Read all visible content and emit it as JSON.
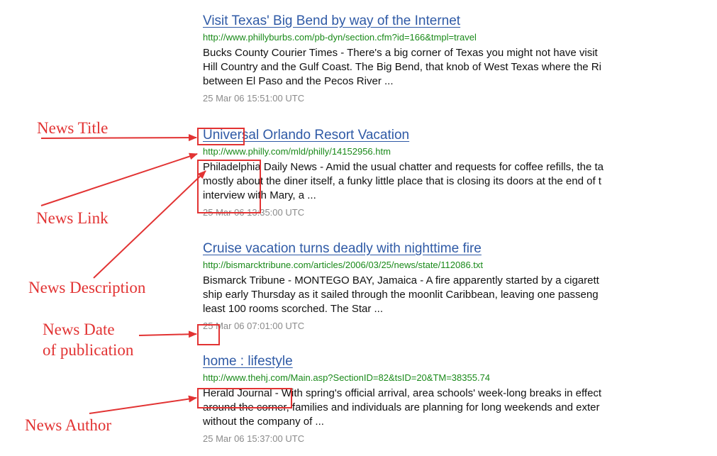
{
  "results": [
    {
      "title": "Visit Texas' Big Bend by way of the Internet",
      "url": "http://www.phillyburbs.com/pb-dyn/section.cfm?id=166&tmpl=travel",
      "desc": "Bucks County Courier Times - There's a big corner of Texas you might not have visit\nHill Country and the Gulf Coast. The Big Bend, that knob of West Texas where the Ri\nbetween El Paso and the Pecos River ...",
      "date": "25 Mar 06 15:51:00 UTC"
    },
    {
      "title": "Universal Orlando Resort Vacation",
      "url": "http://www.philly.com/mld/philly/14152956.htm",
      "desc": "Philadelphia Daily News - Amid the usual chatter and requests for coffee refills, the ta\nmostly about the diner itself, a funky little place that is closing its doors at the end of t\ninterview with Mary, a ...",
      "date": "25 Mar 06 13:35:00 UTC"
    },
    {
      "title": " Cruise vacation turns deadly with nighttime fire",
      "url": "http://bismarcktribune.com/articles/2006/03/25/news/state/112086.txt",
      "desc": "Bismarck Tribune - MONTEGO BAY, Jamaica - A fire apparently started by a cigarett\nship early Thursday as it sailed through the moonlit Caribbean, leaving one passeng\nleast 100 rooms scorched. The Star ...",
      "date": "25 Mar 06 07:01:00 UTC"
    },
    {
      "title": "home : lifestyle",
      "url": "http://www.thehj.com/Main.asp?SectionID=82&tsID=20&TM=38355.74",
      "desc": "Herald Journal - With spring's official arrival, area schools' week-long breaks in effect\naround the corner, families and individuals are planning for long weekends and exter\nwithout the company of ...",
      "date": "25 Mar 06 15:37:00 UTC"
    }
  ],
  "annotations": {
    "news_title": "News Title",
    "news_link": "News Link",
    "news_description": "News Description",
    "news_date_line1": "News Date",
    "news_date_line2": "of publication",
    "news_author": "News Author"
  },
  "colors": {
    "annotation": "#e23333",
    "title_link": "#2f5aa6",
    "url": "#1a8a1a",
    "date": "#8a8a8a"
  }
}
